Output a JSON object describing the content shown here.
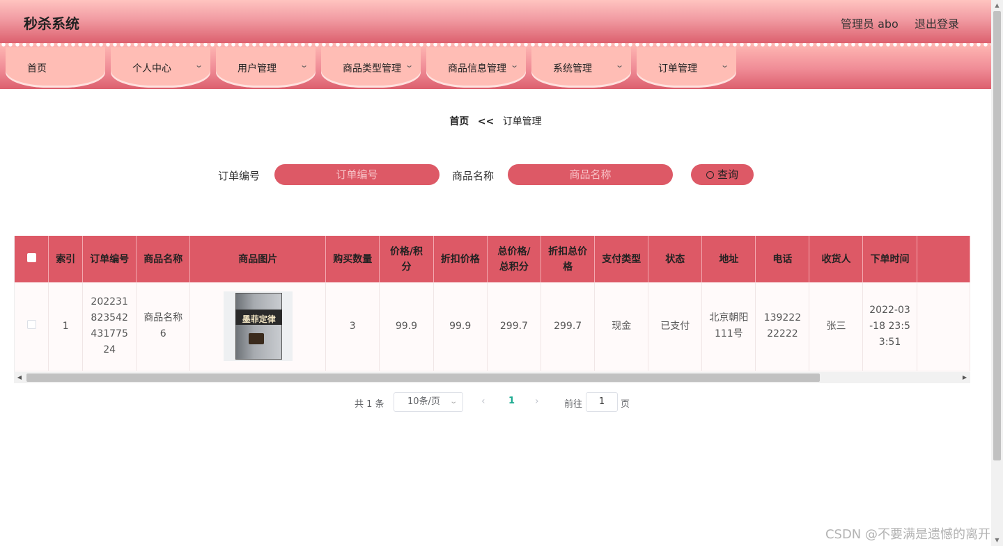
{
  "header": {
    "title": "秒杀系统",
    "admin": "管理员 abo",
    "logout": "退出登录"
  },
  "nav": {
    "items": [
      {
        "label": "首页",
        "has_dropdown": false
      },
      {
        "label": "个人中心",
        "has_dropdown": true
      },
      {
        "label": "用户管理",
        "has_dropdown": true
      },
      {
        "label": "商品类型管理",
        "has_dropdown": true
      },
      {
        "label": "商品信息管理",
        "has_dropdown": true
      },
      {
        "label": "系统管理",
        "has_dropdown": true
      },
      {
        "label": "订单管理",
        "has_dropdown": true
      }
    ],
    "chevron": "⌄"
  },
  "breadcrumb": {
    "home": "首页",
    "separator": "<<",
    "current": "订单管理"
  },
  "search": {
    "order_label": "订单编号",
    "order_placeholder": "订单编号",
    "goods_label": "商品名称",
    "goods_placeholder": "商品名称",
    "button": "查询"
  },
  "table": {
    "columns": [
      "索引",
      "订单编号",
      "商品名称",
      "商品图片",
      "购买数量",
      "价格/积分",
      "折扣价格",
      "总价格/总积分",
      "折扣总价格",
      "支付类型",
      "状态",
      "地址",
      "电话",
      "收货人",
      "下单时间"
    ],
    "rows": [
      {
        "index": "1",
        "order_no": "20223182354243177524",
        "goods_name": "商品名称6",
        "image_title": "墨菲定律",
        "quantity": "3",
        "price": "99.9",
        "discount_price": "99.9",
        "total": "299.7",
        "discount_total": "299.7",
        "pay_type": "现金",
        "status": "已支付",
        "address": "北京朝阳111号",
        "phone": "13922222222",
        "receiver": "张三",
        "order_time": "2022-03-18 23:53:51"
      }
    ]
  },
  "pagination": {
    "total": "共 1 条",
    "page_size": "10条/页",
    "current": "1",
    "goto_label": "前往",
    "goto_value": "1",
    "page_suffix": "页"
  },
  "watermark": "CSDN @不要满是遗憾的离开",
  "colors": {
    "accent": "#dd5966",
    "header_top": "#ffc4c0",
    "header_bottom": "#dc606e",
    "tab": "#ffbdb5",
    "active_page": "#1aaa8f"
  }
}
